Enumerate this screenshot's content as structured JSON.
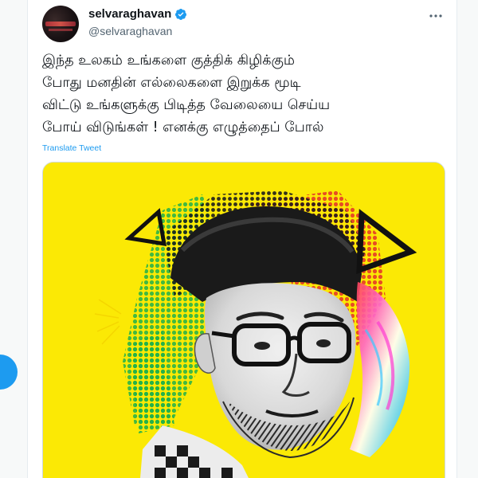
{
  "tweet": {
    "author": {
      "display_name": "selvaraghavan",
      "handle": "@selvaraghavan",
      "verified": true
    },
    "text_lines": [
      "இந்த உலகம் உங்களை குத்திக் கிழிக்கும்",
      "போது மனதின் எல்லைகளை இறுக்க மூடி",
      "விட்டு உங்களுக்கு பிடித்த வேலையை செய்ய",
      "போய் விடுங்கள் ! எனக்கு எழுத்தைப் போல்"
    ],
    "translate_label": "Translate Tweet",
    "more_icon": "more-horizontal-icon",
    "media": {
      "background_color": "#fbe905"
    }
  },
  "colors": {
    "accent": "#1d9bf0",
    "text": "#0f1419",
    "secondary": "#536471"
  }
}
